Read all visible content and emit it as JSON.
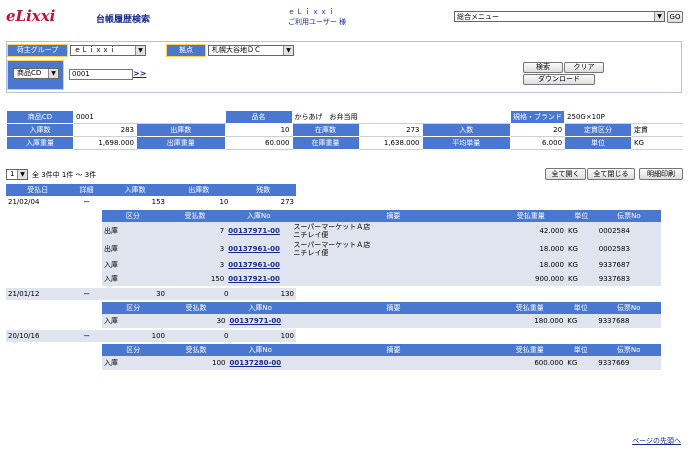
{
  "header": {
    "logo": "eLixxi",
    "page_title": "台帳履歴検索",
    "user_line1": "ｅＬｉｘｘｉ",
    "user_line2": "ご利用ユーザー 様",
    "menu_select": "総合メニュー",
    "go_label": "GO"
  },
  "search": {
    "group_label": "荷主グループ",
    "group_value": "ｅＬｉｘｘｉ",
    "base_label": "拠点",
    "base_value": "札幌大谷地ＤＣ",
    "code_select": "商品CD",
    "code_value": "0001",
    "code_link": ">>",
    "search_button": "検索",
    "clear_button": "クリア",
    "download_button": "ダウンロード"
  },
  "product": {
    "row1": {
      "code_label": "商品CD",
      "code": "0001",
      "name_label": "品名",
      "name": "からあげ　お弁当用",
      "spec_label": "規格・ブランド",
      "spec": "250G×10P"
    },
    "row2": {
      "in_label": "入庫数",
      "in": "283",
      "out_label": "出庫数",
      "out": "10",
      "stock_label": "在庫数",
      "stock": "273",
      "qty_label": "入数",
      "qty": "20",
      "class_label": "定貫区分",
      "class": "定貫"
    },
    "row3": {
      "inw_label": "入庫重量",
      "inw": "1,698.000",
      "outw_label": "出庫重量",
      "outw": "60.000",
      "stockw_label": "在庫重量",
      "stockw": "1,638.000",
      "avg_label": "平均単量",
      "avg": "6.000",
      "unit_label": "単位",
      "unit": "KG"
    }
  },
  "paging": {
    "page": "1",
    "summary": "全 3件中 1件 ～ 3件",
    "open_all": "全て開く",
    "close_all": "全て閉じる",
    "print": "明細印刷"
  },
  "history": {
    "headers": [
      "受払日",
      "詳細",
      "入庫数",
      "出庫数",
      "残数"
    ],
    "detail_headers": [
      "区分",
      "受払数",
      "入庫No",
      "摘要",
      "受払重量",
      "単位",
      "伝票No"
    ],
    "groups": [
      {
        "date": "21/02/04",
        "toggle": "－",
        "in": "153",
        "out": "10",
        "rest": "273",
        "details": [
          {
            "kind": "出庫",
            "qty": "7",
            "no": "00137971-00",
            "memo1": "スーパーマーケットＡ店",
            "memo2": "ニチレイ便",
            "weight": "42.000",
            "unit": "KG",
            "slip": "0002584"
          },
          {
            "kind": "出庫",
            "qty": "3",
            "no": "00137961-00",
            "memo1": "スーパーマーケットＡ店",
            "memo2": "ニチレイ便",
            "weight": "18.000",
            "unit": "KG",
            "slip": "0002583"
          },
          {
            "kind": "入庫",
            "qty": "3",
            "no": "00137961-00",
            "memo1": "",
            "memo2": "",
            "weight": "18.000",
            "unit": "KG",
            "slip": "9337687"
          },
          {
            "kind": "入庫",
            "qty": "150",
            "no": "00137921-00",
            "memo1": "",
            "memo2": "",
            "weight": "900.000",
            "unit": "KG",
            "slip": "9337683"
          }
        ]
      },
      {
        "date": "21/01/12",
        "toggle": "－",
        "in": "30",
        "out": "0",
        "rest": "130",
        "details": [
          {
            "kind": "入庫",
            "qty": "30",
            "no": "00137971-00",
            "memo1": "",
            "memo2": "",
            "weight": "180.000",
            "unit": "KG",
            "slip": "9337688"
          }
        ]
      },
      {
        "date": "20/10/16",
        "toggle": "－",
        "in": "100",
        "out": "0",
        "rest": "100",
        "details": [
          {
            "kind": "入庫",
            "qty": "100",
            "no": "00137280-00",
            "memo1": "",
            "memo2": "",
            "weight": "600.000",
            "unit": "KG",
            "slip": "9337669"
          }
        ]
      }
    ]
  },
  "footer": {
    "top_link": "ページの先頭へ"
  },
  "colors": {
    "header_blue": "#4a78d0",
    "label_border": "#ffd34d",
    "link": "#1a2a8a",
    "logo_red": "#c8102e"
  }
}
